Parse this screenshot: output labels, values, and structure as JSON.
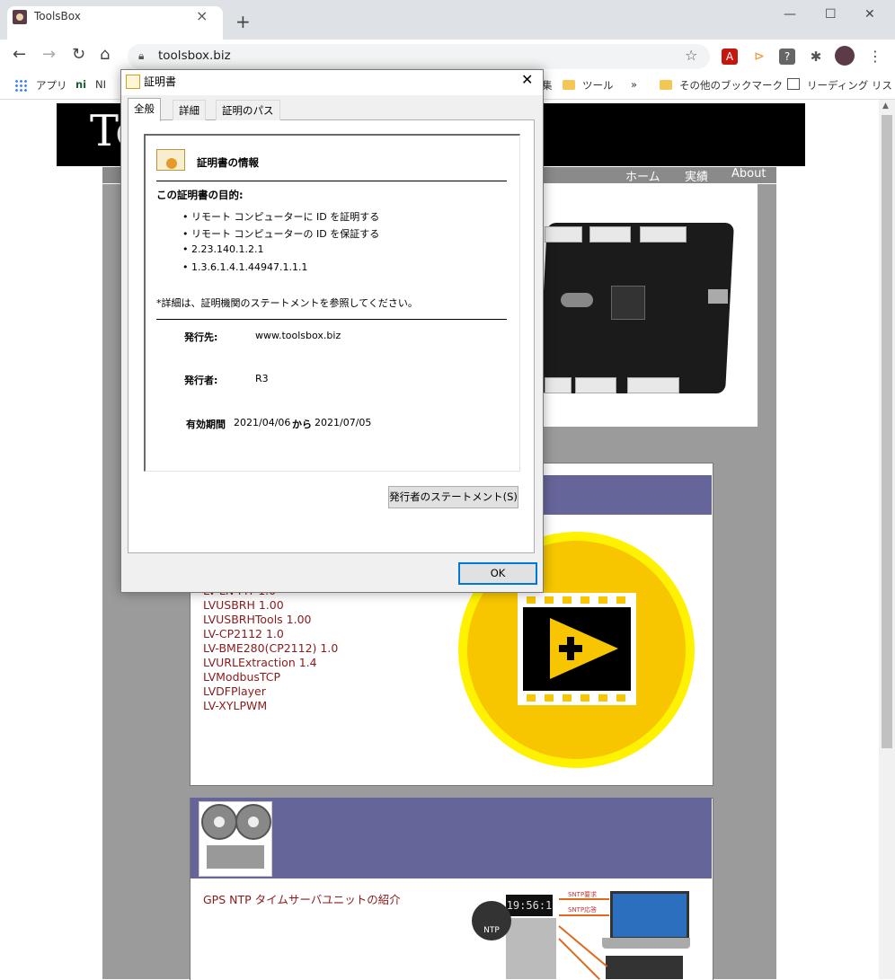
{
  "browser": {
    "tab_title": "ToolsBox",
    "url": "toolsbox.biz",
    "new_tab": "+",
    "window_controls": {
      "minimize": "—",
      "maximize": "☐",
      "close": "✕"
    },
    "bookmarks": {
      "apps": "アプリ",
      "ni": "NI",
      "hidden_left": "集",
      "tools": "ツール",
      "more": "»",
      "other": "その他のブックマーク",
      "reading_list": "リーディング リスト"
    }
  },
  "site": {
    "logo": "To",
    "nav": [
      "ホーム",
      "実績",
      "About"
    ],
    "products": [
      "LV-LN-FIT 1.0",
      "LVUSBRH 1.00",
      "LVUSBRHTools 1.00",
      "LV-CP2112 1.0",
      "LV-BME280(CP2112) 1.0",
      "LVURLExtraction 1.4",
      "LVModbusTCP",
      "LVDFPlayer",
      "LV-XYLPWM"
    ],
    "gps_link": "GPS NTP タイムサーバユニットの紹介",
    "gps_display": "19:56:1",
    "ntp_badge": "NTP",
    "ntp_labels": [
      "SNTP要求",
      "SNTP応答"
    ]
  },
  "dialog": {
    "title": "証明書",
    "tabs": [
      "全般",
      "詳細",
      "証明のパス"
    ],
    "cert_heading": "証明書の情報",
    "purpose_heading": "この証明書の目的:",
    "purposes": [
      "• リモート コンピューターに ID を証明する",
      "• リモート コンピューターの ID を保証する",
      "• 2.23.140.1.2.1",
      "• 1.3.6.1.4.1.44947.1.1.1"
    ],
    "note": "*詳細は、証明機関のステートメントを参照してください。",
    "issued_to_label": "発行先:",
    "issued_to": "www.toolsbox.biz",
    "issued_by_label": "発行者:",
    "issued_by": "R3",
    "valid_label": "有効期間",
    "valid_from": "2021/04/06",
    "valid_word": "から",
    "valid_to": "2021/07/05",
    "issuer_statement_button": "発行者のステートメント(S)",
    "ok_button": "OK"
  },
  "colors": {
    "panel_header": "#66659a",
    "link": "#8b1a1a",
    "video_outer": "#fff200",
    "video_inner": "#f7c600",
    "ok_focus": "#0078d7"
  },
  "icons": [
    "back-icon",
    "forward-icon",
    "reload-icon",
    "home-icon",
    "lock-icon",
    "star-icon",
    "close-icon",
    "certificate-icon",
    "folder-icon",
    "apps-icon"
  ]
}
